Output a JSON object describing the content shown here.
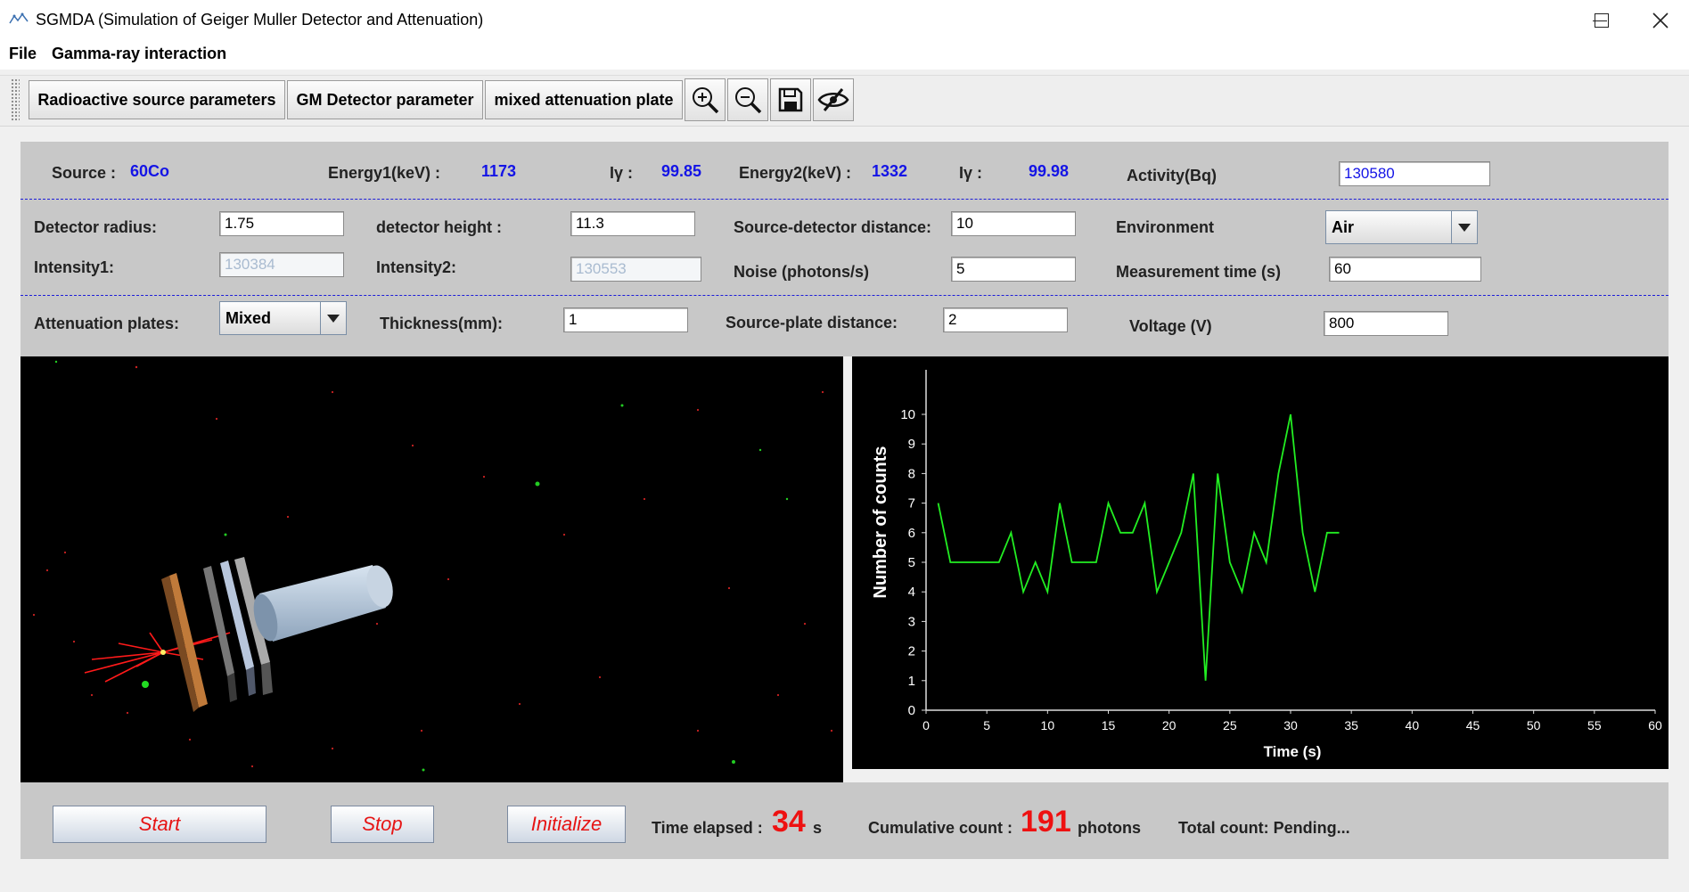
{
  "window": {
    "title": "SGMDA (Simulation of Geiger Muller Detector and Attenuation)"
  },
  "menu": {
    "file": "File",
    "gamma": "Gamma-ray interaction"
  },
  "toolbar": {
    "source_params": "Radioactive source parameters",
    "gm_params": "GM Detector parameter",
    "mixed_plate": "mixed attenuation plate",
    "icons": [
      "zoom-in-icon",
      "zoom-out-icon",
      "save-icon",
      "hide-icon"
    ]
  },
  "source": {
    "source_label": "Source :",
    "source_value": "60Co",
    "energy1_label": "Energy1(keV) :",
    "energy1_value": "1173",
    "iy1_label": "Iγ :",
    "iy1_value": "99.85",
    "energy2_label": "Energy2(keV) :",
    "energy2_value": "1332",
    "iy2_label": "Iγ :",
    "iy2_value": "99.98",
    "activity_label": "Activity(Bq)",
    "activity_value": "130580"
  },
  "detector": {
    "radius_label": "Detector radius:",
    "radius_value": "1.75",
    "height_label": "detector height :",
    "height_value": "11.3",
    "distance_label": "Source-detector distance:",
    "distance_value": "10",
    "environment_label": "Environment",
    "environment_value": "Air",
    "intensity1_label": "Intensity1:",
    "intensity1_value": "130384",
    "intensity2_label": "Intensity2:",
    "intensity2_value": "130553",
    "noise_label": "Noise (photons/s)",
    "noise_value": "5",
    "mtime_label": "Measurement time (s)",
    "mtime_value": "60"
  },
  "attenuation": {
    "plates_label": "Attenuation plates:",
    "plates_value": "Mixed",
    "thickness_label": "Thickness(mm):",
    "thickness_value": "1",
    "plate_distance_label": "Source-plate distance:",
    "plate_distance_value": "2",
    "voltage_label": "Voltage (V)",
    "voltage_value": "800"
  },
  "chart_data": {
    "type": "line",
    "title": "",
    "xlabel": "Time (s)",
    "ylabel": "Number of counts",
    "xlim": [
      0,
      60
    ],
    "ylim": [
      0,
      10
    ],
    "xticks": [
      0,
      5,
      10,
      15,
      20,
      25,
      30,
      35,
      40,
      45,
      50,
      55,
      60
    ],
    "yticks": [
      0,
      1,
      2,
      3,
      4,
      5,
      6,
      7,
      8,
      9,
      10
    ],
    "grid": false,
    "line_color": "#22ee22",
    "background": "#000000",
    "x": [
      1,
      2,
      3,
      4,
      5,
      6,
      7,
      8,
      9,
      10,
      11,
      12,
      13,
      14,
      15,
      16,
      17,
      18,
      19,
      20,
      21,
      22,
      23,
      24,
      25,
      26,
      27,
      28,
      29,
      30,
      31,
      32,
      33,
      34
    ],
    "values": [
      7,
      5,
      5,
      5,
      5,
      5,
      6,
      4,
      5,
      4,
      7,
      5,
      5,
      5,
      7,
      6,
      6,
      7,
      4,
      5,
      6,
      8,
      1,
      8,
      5,
      4,
      6,
      5,
      8,
      10,
      6,
      4,
      6,
      6
    ]
  },
  "controls": {
    "start": "Start",
    "stop": "Stop",
    "initialize": "Initialize",
    "elapsed_label": "Time elapsed :",
    "elapsed_value": "34",
    "elapsed_unit": "s",
    "cumulative_label": "Cumulative count :",
    "cumulative_value": "191",
    "cumulative_unit": "photons",
    "total_label": "Total count: Pending..."
  },
  "colors": {
    "panel": "#c8c8c8",
    "value_blue": "#1414e6",
    "accent_red": "#ee1111",
    "plot_line": "#22ee22"
  }
}
